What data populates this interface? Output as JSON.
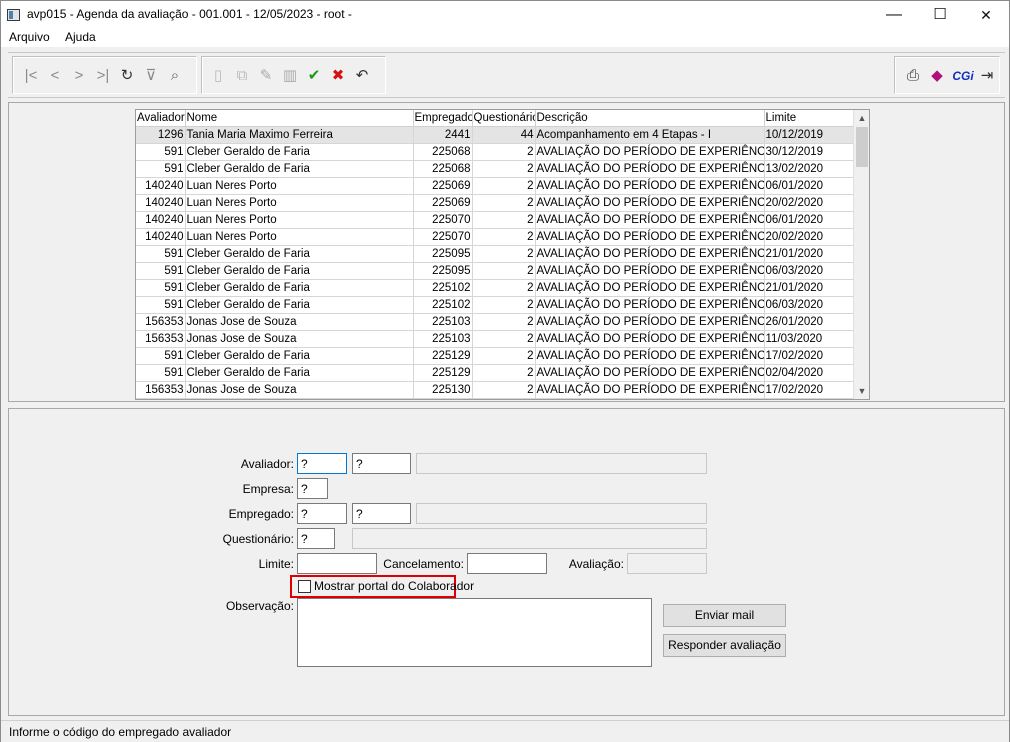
{
  "window": {
    "title": "avp015 - Agenda da avaliação - 001.001 - 12/05/2023 - root -",
    "minimize": "—",
    "maximize": "☐",
    "close": "✕"
  },
  "menu": [
    "Arquivo",
    "Ajuda"
  ],
  "toolbar": {
    "nav_icons": [
      "first-record-icon",
      "previous-record-icon",
      "next-record-icon",
      "last-record-icon",
      "refresh-icon",
      "filter-icon",
      "search-record-icon"
    ],
    "edit_icons": [
      "new-icon",
      "copy-icon",
      "edit-icon",
      "delete-icon",
      "confirm-icon",
      "cancel-icon",
      "undo-icon"
    ],
    "right_icons": [
      "print-icon",
      "help-book-icon",
      "cgi-icon",
      "exit-door-icon"
    ],
    "cgi_label": "CGi",
    "confirm_color": "#1a9a1a",
    "cancel_color": "#d81010"
  },
  "grid": {
    "columns": [
      "Avaliador",
      "Nome",
      "Empregado",
      "Questionário",
      "Descrição",
      "Limite"
    ],
    "rows": [
      [
        "1296",
        "Tania Maria Maximo Ferreira",
        "2441",
        "44",
        "Acompanhamento em 4 Etapas - I",
        "10/12/2019"
      ],
      [
        "591",
        "Cleber Geraldo de Faria",
        "225068",
        "2",
        "AVALIAÇÃO DO PERÍODO DE EXPERIÊNCIA",
        "30/12/2019"
      ],
      [
        "591",
        "Cleber Geraldo de Faria",
        "225068",
        "2",
        "AVALIAÇÃO DO PERÍODO DE EXPERIÊNCIA",
        "13/02/2020"
      ],
      [
        "140240",
        "Luan Neres Porto",
        "225069",
        "2",
        "AVALIAÇÃO DO PERÍODO DE EXPERIÊNCIA",
        "06/01/2020"
      ],
      [
        "140240",
        "Luan Neres Porto",
        "225069",
        "2",
        "AVALIAÇÃO DO PERÍODO DE EXPERIÊNCIA",
        "20/02/2020"
      ],
      [
        "140240",
        "Luan Neres Porto",
        "225070",
        "2",
        "AVALIAÇÃO DO PERÍODO DE EXPERIÊNCIA",
        "06/01/2020"
      ],
      [
        "140240",
        "Luan Neres Porto",
        "225070",
        "2",
        "AVALIAÇÃO DO PERÍODO DE EXPERIÊNCIA",
        "20/02/2020"
      ],
      [
        "591",
        "Cleber Geraldo de Faria",
        "225095",
        "2",
        "AVALIAÇÃO DO PERÍODO DE EXPERIÊNCIA",
        "21/01/2020"
      ],
      [
        "591",
        "Cleber Geraldo de Faria",
        "225095",
        "2",
        "AVALIAÇÃO DO PERÍODO DE EXPERIÊNCIA",
        "06/03/2020"
      ],
      [
        "591",
        "Cleber Geraldo de Faria",
        "225102",
        "2",
        "AVALIAÇÃO DO PERÍODO DE EXPERIÊNCIA",
        "21/01/2020"
      ],
      [
        "591",
        "Cleber Geraldo de Faria",
        "225102",
        "2",
        "AVALIAÇÃO DO PERÍODO DE EXPERIÊNCIA",
        "06/03/2020"
      ],
      [
        "156353",
        "Jonas Jose de Souza",
        "225103",
        "2",
        "AVALIAÇÃO DO PERÍODO DE EXPERIÊNCIA",
        "26/01/2020"
      ],
      [
        "156353",
        "Jonas Jose de Souza",
        "225103",
        "2",
        "AVALIAÇÃO DO PERÍODO DE EXPERIÊNCIA",
        "11/03/2020"
      ],
      [
        "591",
        "Cleber Geraldo de Faria",
        "225129",
        "2",
        "AVALIAÇÃO DO PERÍODO DE EXPERIÊNCIA",
        "17/02/2020"
      ],
      [
        "591",
        "Cleber Geraldo de Faria",
        "225129",
        "2",
        "AVALIAÇÃO DO PERÍODO DE EXPERIÊNCIA",
        "02/04/2020"
      ],
      [
        "156353",
        "Jonas Jose de Souza",
        "225130",
        "2",
        "AVALIAÇÃO DO PERÍODO DE EXPERIÊNCIA",
        "17/02/2020"
      ]
    ]
  },
  "form": {
    "avaliador_label": "Avaliador:",
    "avaliador_code": "?",
    "avaliador_code2": "?",
    "empresa_label": "Empresa:",
    "empresa_code": "?",
    "empregado_label": "Empregado:",
    "empregado_code": "?",
    "empregado_code2": "?",
    "questionario_label": "Questionário:",
    "questionario_code": "?",
    "limite_label": "Limite:",
    "cancelamento_label": "Cancelamento:",
    "avaliacao_label": "Avaliação:",
    "mostrar_portal_label": "Mostrar portal do Colaborador",
    "observacao_label": "Observação:",
    "enviar_mail_label": "Enviar mail",
    "responder_label": "Responder avaliação"
  },
  "status": {
    "text": "Informe o código do empregado avaliador"
  }
}
